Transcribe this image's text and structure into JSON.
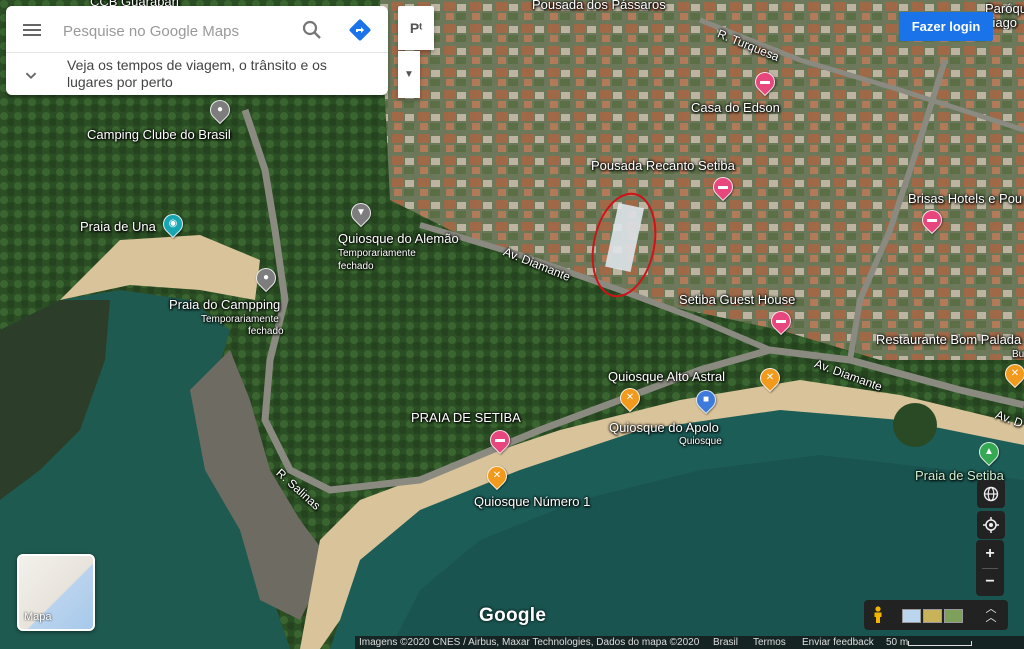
{
  "search": {
    "placeholder": "Pesquise no Google Maps",
    "explore_text": "Veja os tempos de viagem, o trânsito e os lugares por perto"
  },
  "toolbar": {
    "pt_label": "Pᵗ",
    "login_label": "Fazer login"
  },
  "map_labels": {
    "top_cut": "CCB Guarapari",
    "top_right_cut": "Paróquia\nTiago",
    "pousada_passaros": "Pousada dos Pássaros",
    "r_turquesa": "R. Turquesa",
    "casa_edson": "Casa do Edson",
    "camping_clube": "Camping Clube do Brasil",
    "pousada_recanto": "Pousada Recanto Setiba",
    "brisas": "Brisas Hotels e Pou",
    "praia_una": "Praia de Una",
    "quiosque_alemao": "Quiosque do Alemão",
    "quiosque_alemao_status": "Temporariamente",
    "quiosque_alemao_status2": "fechado",
    "av_diamante": "Av. Diamante",
    "praia_campping": "Praia do Campping",
    "praia_campping_status": "Temporariamente",
    "praia_campping_status2": "fechado",
    "setiba_guest": "Setiba Guest House",
    "restaurante": "Restaurante Bom Palada",
    "restaurante_sub": "Bu",
    "av_diamante2": "Av. Diamante",
    "av_right": "Av. D",
    "quiosque_alto_astral": "Quiosque Alto Astral",
    "praia_setiba_caps": "PRAIA DE SETIBA",
    "quiosque_apolo": "Quiosque do Apolo",
    "quiosque_apolo_sub": "Quiosque",
    "r_salinas": "R. Salinas",
    "quiosque_numero1": "Quiosque Número 1",
    "praia_setiba": "Praia de Setiba"
  },
  "minimap": {
    "label": "Mapa"
  },
  "controls": {
    "zoom_in": "+",
    "zoom_out": "−"
  },
  "footer": {
    "google": "Google",
    "imagery": "Imagens ©2020 CNES / Airbus, Maxar Technologies, Dados do mapa ©2020",
    "country": "Brasil",
    "terms": "Termos",
    "feedback": "Enviar feedback",
    "scale": "50 m"
  },
  "colors": {
    "accent": "#1a73e8",
    "hotel_pin": "#e7477c",
    "food_pin": "#f29a1e",
    "place_pin": "#7d7d7d",
    "annotation_circle": "#d0121b"
  }
}
